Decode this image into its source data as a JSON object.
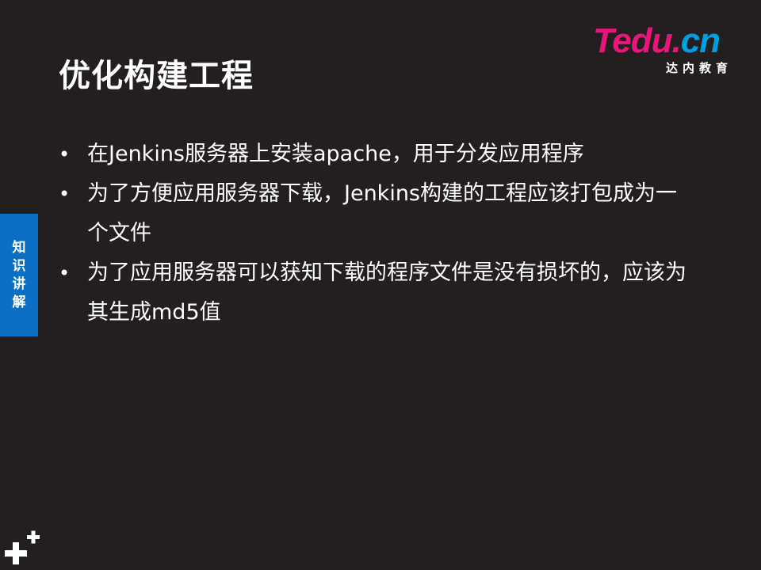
{
  "slide": {
    "title": "优化构建工程",
    "logo": {
      "word_t": "T",
      "word_rest": "edu.",
      "word_cn": "cn",
      "subtitle": "达内教育"
    },
    "bullets": [
      {
        "marker": "•",
        "text": "在Jenkins服务器上安装apache，用于分发应用程序"
      },
      {
        "marker": "•",
        "text": "为了方便应用服务器下载，Jenkins构建的工程应该打包成为一个文件"
      },
      {
        "marker": "•",
        "text": "为了应用服务器可以获知下载的程序文件是没有损坏的，应该为其生成md5值"
      }
    ],
    "side_tab": [
      "知",
      "识",
      "讲",
      "解"
    ],
    "icons": {
      "corner": "plus-icon"
    },
    "colors": {
      "background": "#231f20",
      "tab": "#0b6fc4",
      "logo_pink": "#e8157a",
      "logo_blue": "#00a0e0"
    }
  }
}
